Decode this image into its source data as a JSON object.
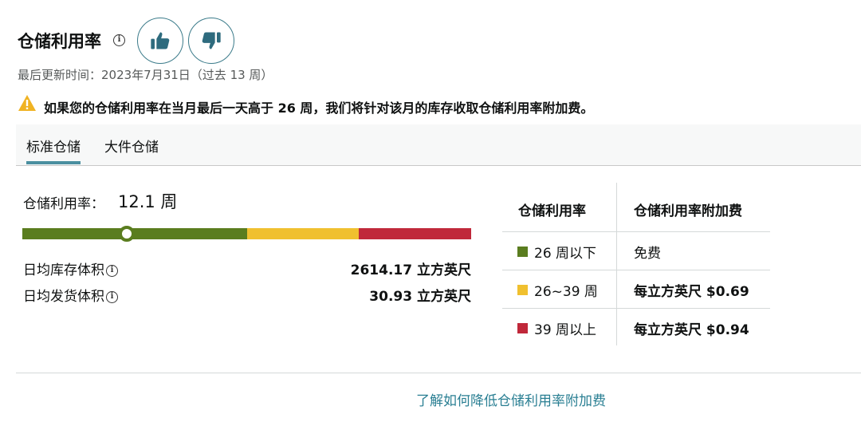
{
  "header": {
    "title": "仓储利用率",
    "info_icon": "info-icon",
    "thumbs_up_icon": "thumbs-up-icon",
    "thumbs_down_icon": "thumbs-down-icon"
  },
  "updated_text": "最后更新时间：2023年7月31日（过去 13 周）",
  "warning": {
    "icon": "warning-icon",
    "text": "如果您的仓储利用率在当月最后一天高于 26 周，我们将针对该月的库存收取仓储利用率附加费。"
  },
  "tabs": [
    {
      "label": "标准仓储",
      "active": true
    },
    {
      "label": "大件仓储",
      "active": false
    }
  ],
  "utilization": {
    "label": "仓储利用率：",
    "value": "12.1 周",
    "gauge_value_weeks": 12.1,
    "gauge_segments": [
      {
        "color": "#5a7d1f",
        "from_weeks": 0,
        "to_weeks": 26
      },
      {
        "color": "#f0c02f",
        "from_weeks": 26,
        "to_weeks": 39
      },
      {
        "color": "#c0283a",
        "from_weeks": 39,
        "to_weeks": 52
      }
    ]
  },
  "metrics": [
    {
      "label": "日均库存体积",
      "value": "2614.17 立方英尺"
    },
    {
      "label": "日均发货体积",
      "value": "30.93 立方英尺"
    }
  ],
  "fee_table": {
    "headers": [
      "仓储利用率",
      "仓储利用率附加费"
    ],
    "rows": [
      {
        "color": "#5a7d1f",
        "tier": "26 周以下",
        "fee": "免费"
      },
      {
        "color": "#f0c02f",
        "tier": "26~39 周",
        "fee": "每立方英尺 $0.69"
      },
      {
        "color": "#c0283a",
        "tier": "39 周以上",
        "fee": "每立方英尺 $0.94"
      }
    ]
  },
  "learn_more_link": "了解如何降低仓储利用率附加费"
}
